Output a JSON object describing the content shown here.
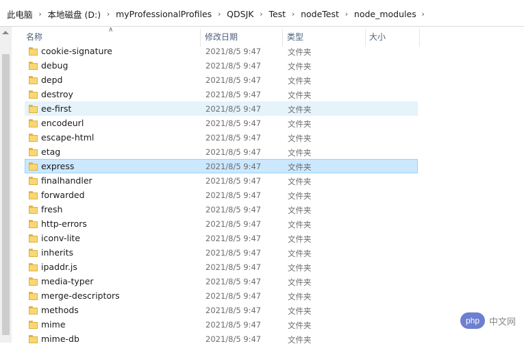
{
  "breadcrumb": [
    "此电脑",
    "本地磁盘 (D:)",
    "myProfessionalProfiles",
    "QDSJK",
    "Test",
    "nodeTest",
    "node_modules"
  ],
  "columns": {
    "name": "名称",
    "date": "修改日期",
    "type": "类型",
    "size": "大小"
  },
  "sort": {
    "column": "name",
    "direction": "ascending",
    "icon": "chevron-up-icon"
  },
  "rows": [
    {
      "name": "cookie-signature",
      "date": "2021/8/5 9:47",
      "type": "文件夹"
    },
    {
      "name": "debug",
      "date": "2021/8/5 9:47",
      "type": "文件夹"
    },
    {
      "name": "depd",
      "date": "2021/8/5 9:47",
      "type": "文件夹"
    },
    {
      "name": "destroy",
      "date": "2021/8/5 9:47",
      "type": "文件夹"
    },
    {
      "name": "ee-first",
      "date": "2021/8/5 9:47",
      "type": "文件夹",
      "state": "hover"
    },
    {
      "name": "encodeurl",
      "date": "2021/8/5 9:47",
      "type": "文件夹"
    },
    {
      "name": "escape-html",
      "date": "2021/8/5 9:47",
      "type": "文件夹"
    },
    {
      "name": "etag",
      "date": "2021/8/5 9:47",
      "type": "文件夹"
    },
    {
      "name": "express",
      "date": "2021/8/5 9:47",
      "type": "文件夹",
      "state": "selected"
    },
    {
      "name": "finalhandler",
      "date": "2021/8/5 9:47",
      "type": "文件夹"
    },
    {
      "name": "forwarded",
      "date": "2021/8/5 9:47",
      "type": "文件夹"
    },
    {
      "name": "fresh",
      "date": "2021/8/5 9:47",
      "type": "文件夹"
    },
    {
      "name": "http-errors",
      "date": "2021/8/5 9:47",
      "type": "文件夹"
    },
    {
      "name": "iconv-lite",
      "date": "2021/8/5 9:47",
      "type": "文件夹"
    },
    {
      "name": "inherits",
      "date": "2021/8/5 9:47",
      "type": "文件夹"
    },
    {
      "name": "ipaddr.js",
      "date": "2021/8/5 9:47",
      "type": "文件夹"
    },
    {
      "name": "media-typer",
      "date": "2021/8/5 9:47",
      "type": "文件夹"
    },
    {
      "name": "merge-descriptors",
      "date": "2021/8/5 9:47",
      "type": "文件夹"
    },
    {
      "name": "methods",
      "date": "2021/8/5 9:47",
      "type": "文件夹"
    },
    {
      "name": "mime",
      "date": "2021/8/5 9:47",
      "type": "文件夹"
    },
    {
      "name": "mime-db",
      "date": "2021/8/5 9:47",
      "type": "文件夹"
    }
  ],
  "watermark": {
    "badge": "php",
    "text": "中文网"
  },
  "colors": {
    "hover": "#e5f3fb",
    "selected": "#cce8ff",
    "selected_border": "#99d1ff",
    "folder": "#f8d775"
  }
}
